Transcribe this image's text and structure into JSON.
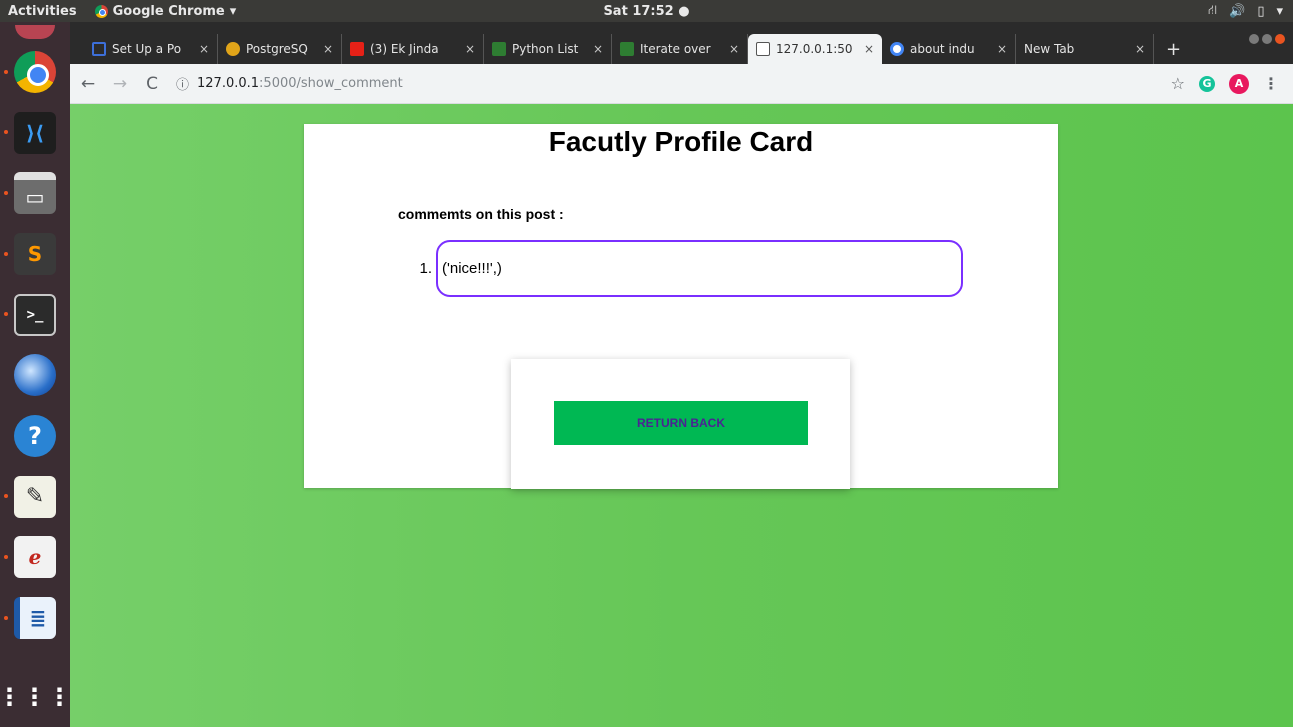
{
  "system": {
    "activities": "Activities",
    "app_name": "Google Chrome",
    "app_menu_caret": "▾",
    "clock": "Sat 17:52 ●",
    "tray_icons": [
      "network-icon",
      "volume-icon",
      "battery-icon",
      "menu-caret-icon"
    ]
  },
  "dock": {
    "items": [
      {
        "name": "chrome",
        "glyph": ""
      },
      {
        "name": "vscode",
        "glyph": "⟩⟨"
      },
      {
        "name": "files",
        "glyph": "▭"
      },
      {
        "name": "sublime",
        "glyph": "S"
      },
      {
        "name": "terminal",
        "glyph": ">_"
      },
      {
        "name": "thunderbird",
        "glyph": ""
      },
      {
        "name": "help",
        "glyph": "?"
      },
      {
        "name": "text-editor",
        "glyph": "✎"
      },
      {
        "name": "pdf-viewer",
        "glyph": "ℯ"
      },
      {
        "name": "writer",
        "glyph": "≣"
      },
      {
        "name": "show-apps",
        "glyph": "⋮⋮⋮"
      }
    ]
  },
  "browser": {
    "tabs": [
      {
        "label": "Set Up a Po",
        "favicon_color": "#3d6fd9",
        "active": false
      },
      {
        "label": "PostgreSQ",
        "favicon_color": "#e0a419",
        "active": false
      },
      {
        "label": "(3) Ek Jinda",
        "favicon_color": "#e62117",
        "active": false
      },
      {
        "label": "Python List",
        "favicon_color": "#2e7d32",
        "active": false
      },
      {
        "label": "Iterate over",
        "favicon_color": "#2e7d32",
        "active": false
      },
      {
        "label": "127.0.0.1:50",
        "favicon_color": "#ffffff",
        "active": true
      },
      {
        "label": "about indu",
        "favicon_color": "#4285f4",
        "active": false
      },
      {
        "label": "New Tab",
        "favicon_color": "",
        "active": false
      }
    ],
    "close_glyph": "×",
    "new_tab_glyph": "+",
    "url_host": "127.0.0.1",
    "url_path": ":5000/show_comment",
    "extension_label": "G",
    "avatar_letter": "A"
  },
  "page": {
    "title": "Facutly Profile Card",
    "comments_heading": "commemts on this post :",
    "comments": [
      {
        "number": "1.",
        "text": "('nice!!!',)"
      }
    ],
    "return_button": "RETURN BACK"
  },
  "colors": {
    "accent_green": "#00b853",
    "comment_border": "#7a2fff",
    "button_text": "#4b2393"
  }
}
